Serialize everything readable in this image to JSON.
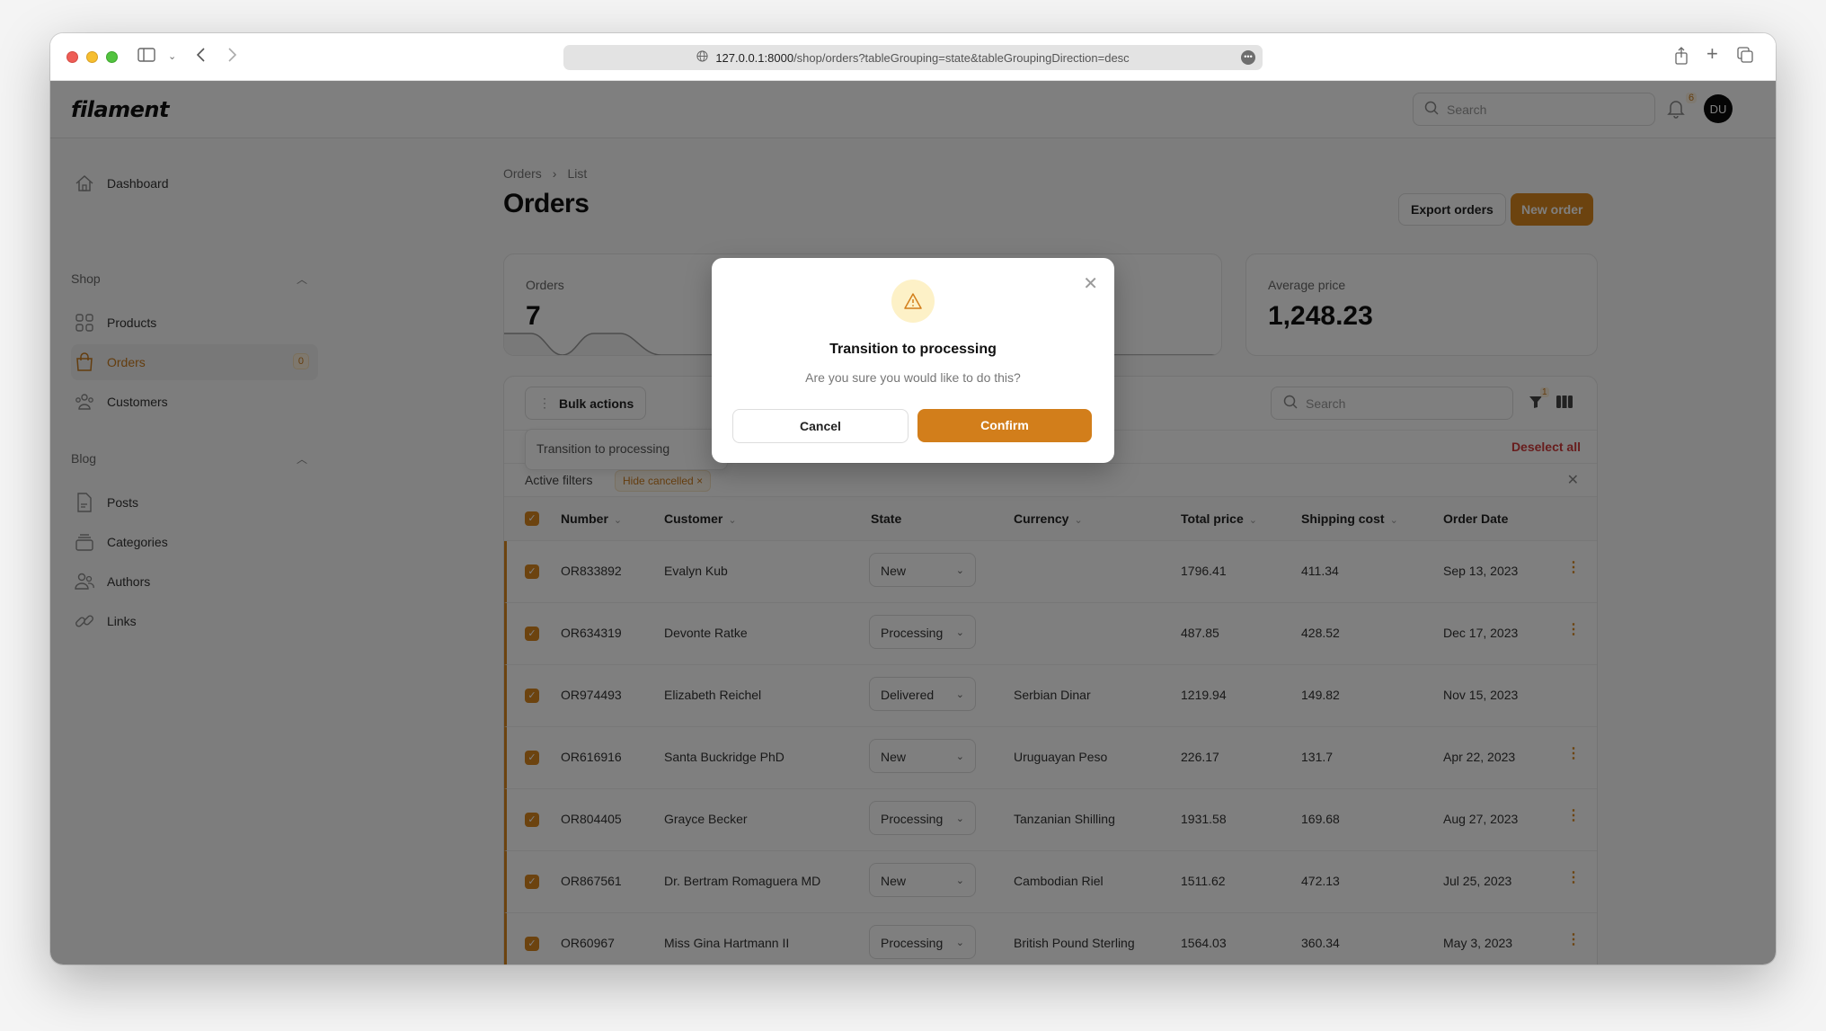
{
  "browser": {
    "url_host": "127.0.0.1:8000",
    "url_path": "/shop/orders?tableGrouping=state&tableGroupingDirection=desc"
  },
  "topbar": {
    "logo": "filament",
    "search_placeholder": "Search",
    "notifications_count": "6",
    "user_initials": "DU"
  },
  "sidebar": {
    "dashboard": "Dashboard",
    "groups": [
      {
        "label": "Shop",
        "items": [
          {
            "label": "Products"
          },
          {
            "label": "Orders",
            "badge": "0",
            "active": true
          },
          {
            "label": "Customers"
          }
        ]
      },
      {
        "label": "Blog",
        "items": [
          {
            "label": "Posts"
          },
          {
            "label": "Categories"
          },
          {
            "label": "Authors"
          },
          {
            "label": "Links"
          }
        ]
      }
    ]
  },
  "page": {
    "breadcrumb": [
      "Orders",
      "List"
    ],
    "title": "Orders",
    "export_label": "Export orders",
    "new_label": "New order"
  },
  "stats": [
    {
      "label": "Orders",
      "value": "7"
    },
    {
      "label": "Average price",
      "value": "1,248.23"
    }
  ],
  "table": {
    "bulk_actions_label": "Bulk actions",
    "bulk_menu_item": "Transition to processing",
    "search_placeholder": "Search",
    "filter_count": "1",
    "deselect_all": "Deselect all",
    "active_filters_label": "Active filters",
    "active_filter_chip": "Hide cancelled",
    "columns": [
      "Number",
      "Customer",
      "State",
      "Currency",
      "Total price",
      "Shipping cost",
      "Order Date"
    ],
    "rows": [
      {
        "number": "OR833892",
        "customer": "Evalyn Kub",
        "state": "New",
        "currency": "",
        "total": "1796.41",
        "shipping": "411.34",
        "date": "Sep 13, 2023",
        "menu": true
      },
      {
        "number": "OR634319",
        "customer": "Devonte Ratke",
        "state": "Processing",
        "currency": "",
        "total": "487.85",
        "shipping": "428.52",
        "date": "Dec 17, 2023",
        "menu": true
      },
      {
        "number": "OR974493",
        "customer": "Elizabeth Reichel",
        "state": "Delivered",
        "currency": "Serbian Dinar",
        "total": "1219.94",
        "shipping": "149.82",
        "date": "Nov 15, 2023",
        "menu": false
      },
      {
        "number": "OR616916",
        "customer": "Santa Buckridge PhD",
        "state": "New",
        "currency": "Uruguayan Peso",
        "total": "226.17",
        "shipping": "131.7",
        "date": "Apr 22, 2023",
        "menu": true
      },
      {
        "number": "OR804405",
        "customer": "Grayce Becker",
        "state": "Processing",
        "currency": "Tanzanian Shilling",
        "total": "1931.58",
        "shipping": "169.68",
        "date": "Aug 27, 2023",
        "menu": true
      },
      {
        "number": "OR867561",
        "customer": "Dr. Bertram Romaguera MD",
        "state": "New",
        "currency": "Cambodian Riel",
        "total": "1511.62",
        "shipping": "472.13",
        "date": "Jul 25, 2023",
        "menu": true
      },
      {
        "number": "OR60967",
        "customer": "Miss Gina Hartmann II",
        "state": "Processing",
        "currency": "British Pound Sterling",
        "total": "1564.03",
        "shipping": "360.34",
        "date": "May 3, 2023",
        "menu": true
      }
    ]
  },
  "modal": {
    "title": "Transition to processing",
    "description": "Are you sure you would like to do this?",
    "cancel_label": "Cancel",
    "confirm_label": "Confirm"
  },
  "colors": {
    "primary": "#d9871e",
    "danger": "#d03b3b"
  }
}
